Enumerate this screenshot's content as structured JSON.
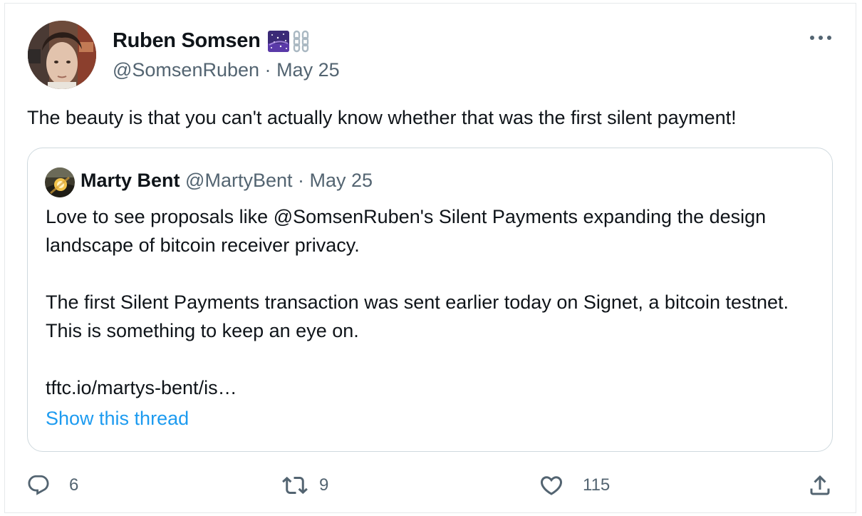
{
  "tweet": {
    "author": {
      "name": "Ruben Somsen",
      "handle": "@SomsenRuben",
      "date": "May 25",
      "separator": "·"
    },
    "text": "The beauty is that you can't actually know whether that was the first silent payment!",
    "quoted": {
      "author_name": "Marty Bent",
      "handle": "@MartyBent",
      "date": "May 25",
      "separator": "·",
      "paragraphs": [
        "Love to see proposals like @SomsenRuben's Silent Payments expanding the design landscape of bitcoin receiver privacy.",
        "The first Silent Payments transaction was sent earlier today on Signet, a bitcoin testnet. This is something to keep an eye on.",
        "tftc.io/martys-bent/is…"
      ],
      "show_thread_label": "Show this thread"
    },
    "actions": {
      "replies": "6",
      "retweets": "9",
      "likes": "115"
    }
  },
  "icons": {
    "more": "more-icon",
    "reply": "reply-icon",
    "retweet": "retweet-icon",
    "like": "heart-icon",
    "share": "share-icon",
    "badge1": "galaxy-emoji-icon",
    "badge2": "chain-emoji-icon"
  },
  "colors": {
    "text": "#0f1419",
    "secondary": "#536471",
    "link": "#1d9bf0",
    "border": "#cfd9de"
  }
}
